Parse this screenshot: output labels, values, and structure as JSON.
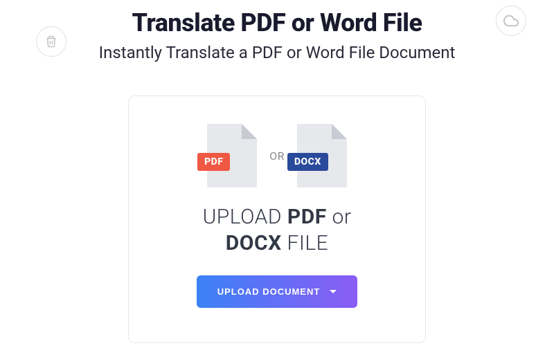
{
  "header": {
    "title": "Translate PDF or Word File",
    "subtitle": "Instantly Translate a PDF or Word File Document"
  },
  "card": {
    "pdf_badge": "PDF",
    "docx_badge": "DOCX",
    "or_label": "OR",
    "upload_prefix": "UPLOAD ",
    "upload_pdf": "PDF",
    "upload_mid": " or ",
    "upload_docx": "DOCX",
    "upload_suffix": " FILE",
    "button_label": "UPLOAD DOCUMENT"
  }
}
